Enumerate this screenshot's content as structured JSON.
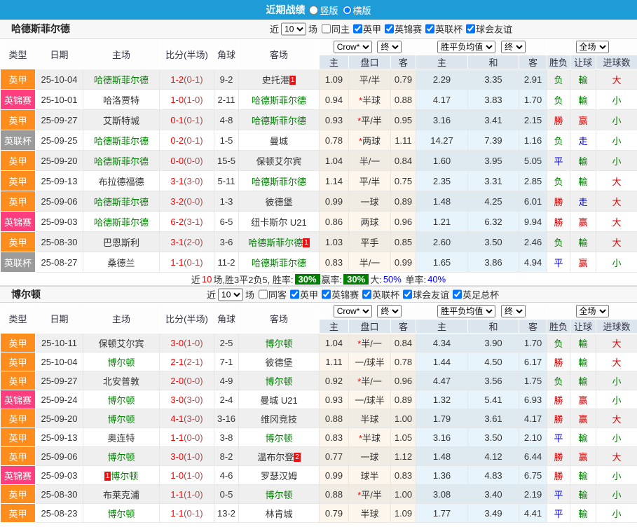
{
  "topbar": {
    "title": "近期战绩",
    "radio_vertical": "竖版",
    "radio_horizontal": "横版",
    "vertical_checked": false,
    "horizontal_checked": true
  },
  "labels": {
    "near": "近",
    "matches": "场"
  },
  "table_headers": {
    "type": "类型",
    "date": "日期",
    "home": "主场",
    "score": "比分(半场)",
    "corner": "角球",
    "away": "客场",
    "odds_home": "主",
    "handicap": "盘口",
    "odds_away": "客",
    "avg_home": "主",
    "avg_draw": "和",
    "avg_away": "客",
    "result": "胜负",
    "let_goal": "让球",
    "goals": "进球数",
    "bookmaker": "Crow*",
    "final": "终",
    "avg_label": "胜平负均值",
    "fullmatch": "全场"
  },
  "sections": [
    {
      "team": "哈德斯菲尔德",
      "filter": {
        "count": "10",
        "same_label": "同主",
        "same_checked": false,
        "leagues": [
          {
            "label": "英甲",
            "checked": true
          },
          {
            "label": "英锦赛",
            "checked": true
          },
          {
            "label": "英联杯",
            "checked": true
          },
          {
            "label": "球会友谊",
            "checked": true
          }
        ]
      },
      "rows": [
        {
          "type": "英甲",
          "tcls": "lg-orange",
          "date": "25-10-04",
          "home": {
            "text": "哈德斯菲尔德",
            "cls": "team-green",
            "badge_pre": "",
            "badge": ""
          },
          "score": "1-2",
          "half": "(0-1)",
          "corner": "9-2",
          "away": {
            "text": "史托港",
            "cls": "",
            "badge_pre": "",
            "badge": "1"
          },
          "o1": "1.09",
          "hstar": "",
          "hc": "平/半",
          "o2": "0.79",
          "a1": "2.29",
          "a2": "3.35",
          "a3": "2.91",
          "res": {
            "text": "负",
            "cls": "g"
          },
          "let": {
            "text": "輸",
            "cls": "g"
          },
          "goal": {
            "text": "大",
            "cls": "r"
          }
        },
        {
          "type": "英锦赛",
          "tcls": "lg-pink",
          "date": "25-10-01",
          "home": {
            "text": "哈洛贾特",
            "cls": "",
            "badge_pre": "",
            "badge": ""
          },
          "score": "1-0",
          "half": "(1-0)",
          "corner": "2-11",
          "away": {
            "text": "哈德斯菲尔德",
            "cls": "team-green",
            "badge_pre": "",
            "badge": ""
          },
          "o1": "0.94",
          "hstar": "*",
          "hc": "半球",
          "o2": "0.88",
          "a1": "4.17",
          "a2": "3.83",
          "a3": "1.70",
          "res": {
            "text": "负",
            "cls": "g"
          },
          "let": {
            "text": "輸",
            "cls": "g"
          },
          "goal": {
            "text": "小",
            "cls": "g"
          }
        },
        {
          "type": "英甲",
          "tcls": "lg-orange",
          "date": "25-09-27",
          "home": {
            "text": "艾斯特城",
            "cls": "",
            "badge_pre": "",
            "badge": ""
          },
          "score": "0-1",
          "half": "(0-1)",
          "corner": "4-8",
          "away": {
            "text": "哈德斯菲尔德",
            "cls": "team-green",
            "badge_pre": "",
            "badge": ""
          },
          "o1": "0.93",
          "hstar": "*",
          "hc": "平/半",
          "o2": "0.95",
          "a1": "3.16",
          "a2": "3.41",
          "a3": "2.15",
          "res": {
            "text": "勝",
            "cls": "r"
          },
          "let": {
            "text": "赢",
            "cls": "r"
          },
          "goal": {
            "text": "小",
            "cls": "g"
          }
        },
        {
          "type": "英联杯",
          "tcls": "lg-gray",
          "date": "25-09-25",
          "home": {
            "text": "哈德斯菲尔德",
            "cls": "team-green",
            "badge_pre": "",
            "badge": ""
          },
          "score": "0-2",
          "half": "(0-1)",
          "corner": "1-5",
          "away": {
            "text": "曼城",
            "cls": "",
            "badge_pre": "",
            "badge": ""
          },
          "o1": "0.78",
          "hstar": "*",
          "hc": "两球",
          "o2": "1.11",
          "a1": "14.27",
          "a2": "7.39",
          "a3": "1.16",
          "res": {
            "text": "负",
            "cls": "g"
          },
          "let": {
            "text": "走",
            "cls": "b"
          },
          "goal": {
            "text": "小",
            "cls": "g"
          }
        },
        {
          "type": "英甲",
          "tcls": "lg-orange",
          "date": "25-09-20",
          "home": {
            "text": "哈德斯菲尔德",
            "cls": "team-green",
            "badge_pre": "",
            "badge": ""
          },
          "score": "0-0",
          "half": "(0-0)",
          "corner": "15-5",
          "away": {
            "text": "保顿艾尔宾",
            "cls": "",
            "badge_pre": "",
            "badge": ""
          },
          "o1": "1.04",
          "hstar": "",
          "hc": "半/一",
          "o2": "0.84",
          "a1": "1.60",
          "a2": "3.95",
          "a3": "5.05",
          "res": {
            "text": "平",
            "cls": "b"
          },
          "let": {
            "text": "輸",
            "cls": "g"
          },
          "goal": {
            "text": "小",
            "cls": "g"
          }
        },
        {
          "type": "英甲",
          "tcls": "lg-orange",
          "date": "25-09-13",
          "home": {
            "text": "布拉德福德",
            "cls": "",
            "badge_pre": "",
            "badge": ""
          },
          "score": "3-1",
          "half": "(3-0)",
          "corner": "5-11",
          "away": {
            "text": "哈德斯菲尔德",
            "cls": "team-green",
            "badge_pre": "",
            "badge": ""
          },
          "o1": "1.14",
          "hstar": "",
          "hc": "平/半",
          "o2": "0.75",
          "a1": "2.35",
          "a2": "3.31",
          "a3": "2.85",
          "res": {
            "text": "负",
            "cls": "g"
          },
          "let": {
            "text": "輸",
            "cls": "g"
          },
          "goal": {
            "text": "大",
            "cls": "r"
          }
        },
        {
          "type": "英甲",
          "tcls": "lg-orange",
          "date": "25-09-06",
          "home": {
            "text": "哈德斯菲尔德",
            "cls": "team-green",
            "badge_pre": "",
            "badge": ""
          },
          "score": "3-2",
          "half": "(0-0)",
          "corner": "1-3",
          "away": {
            "text": "彼德堡",
            "cls": "",
            "badge_pre": "",
            "badge": ""
          },
          "o1": "0.99",
          "hstar": "",
          "hc": "一球",
          "o2": "0.89",
          "a1": "1.48",
          "a2": "4.25",
          "a3": "6.01",
          "res": {
            "text": "勝",
            "cls": "r"
          },
          "let": {
            "text": "走",
            "cls": "b"
          },
          "goal": {
            "text": "大",
            "cls": "r"
          }
        },
        {
          "type": "英锦赛",
          "tcls": "lg-pink",
          "date": "25-09-03",
          "home": {
            "text": "哈德斯菲尔德",
            "cls": "team-green",
            "badge_pre": "",
            "badge": ""
          },
          "score": "6-2",
          "half": "(3-1)",
          "corner": "6-5",
          "away": {
            "text": "纽卡斯尔 U21",
            "cls": "",
            "badge_pre": "",
            "badge": ""
          },
          "o1": "0.86",
          "hstar": "",
          "hc": "两球",
          "o2": "0.96",
          "a1": "1.21",
          "a2": "6.32",
          "a3": "9.94",
          "res": {
            "text": "勝",
            "cls": "r"
          },
          "let": {
            "text": "赢",
            "cls": "r"
          },
          "goal": {
            "text": "大",
            "cls": "r"
          }
        },
        {
          "type": "英甲",
          "tcls": "lg-orange",
          "date": "25-08-30",
          "home": {
            "text": "巴恩斯利",
            "cls": "",
            "badge_pre": "",
            "badge": ""
          },
          "score": "3-1",
          "half": "(2-0)",
          "corner": "3-6",
          "away": {
            "text": "哈德斯菲尔德",
            "cls": "team-green",
            "badge_pre": "",
            "badge": "1"
          },
          "o1": "1.03",
          "hstar": "",
          "hc": "平手",
          "o2": "0.85",
          "a1": "2.60",
          "a2": "3.50",
          "a3": "2.46",
          "res": {
            "text": "负",
            "cls": "g"
          },
          "let": {
            "text": "輸",
            "cls": "g"
          },
          "goal": {
            "text": "大",
            "cls": "r"
          }
        },
        {
          "type": "英联杯",
          "tcls": "lg-gray",
          "date": "25-08-27",
          "home": {
            "text": "桑德兰",
            "cls": "",
            "badge_pre": "",
            "badge": ""
          },
          "score": "1-1",
          "half": "(0-1)",
          "corner": "11-2",
          "away": {
            "text": "哈德斯菲尔德",
            "cls": "team-green",
            "badge_pre": "",
            "badge": ""
          },
          "o1": "0.83",
          "hstar": "",
          "hc": "半/一",
          "o2": "0.99",
          "a1": "1.65",
          "a2": "3.86",
          "a3": "4.94",
          "res": {
            "text": "平",
            "cls": "b"
          },
          "let": {
            "text": "赢",
            "cls": "r"
          },
          "goal": {
            "text": "小",
            "cls": "g"
          }
        }
      ],
      "summary": {
        "pre": "近",
        "n": "10",
        "mid": "场,胜3平2负5, 胜率:",
        "rate1": "30%",
        "mid2": "赢率:",
        "rate2": "30%",
        "mid3": "大:",
        "big": "50%",
        "mid4": "单率:",
        "single": "40%"
      }
    },
    {
      "team": "博尔顿",
      "filter": {
        "count": "10",
        "same_label": "同客",
        "same_checked": false,
        "leagues": [
          {
            "label": "英甲",
            "checked": true
          },
          {
            "label": "英锦赛",
            "checked": true
          },
          {
            "label": "英联杯",
            "checked": true
          },
          {
            "label": "球会友谊",
            "checked": true
          },
          {
            "label": "英足总杯",
            "checked": true
          }
        ]
      },
      "rows": [
        {
          "type": "英甲",
          "tcls": "lg-orange",
          "date": "25-10-11",
          "home": {
            "text": "保顿艾尔宾",
            "cls": "",
            "badge_pre": "",
            "badge": ""
          },
          "score": "3-0",
          "half": "(1-0)",
          "corner": "2-5",
          "away": {
            "text": "博尔顿",
            "cls": "team-green",
            "badge_pre": "",
            "badge": ""
          },
          "o1": "1.04",
          "hstar": "*",
          "hc": "半/一",
          "o2": "0.84",
          "a1": "4.34",
          "a2": "3.90",
          "a3": "1.70",
          "res": {
            "text": "负",
            "cls": "g"
          },
          "let": {
            "text": "輸",
            "cls": "g"
          },
          "goal": {
            "text": "大",
            "cls": "r"
          }
        },
        {
          "type": "英甲",
          "tcls": "lg-orange",
          "date": "25-10-04",
          "home": {
            "text": "博尔顿",
            "cls": "team-green",
            "badge_pre": "",
            "badge": ""
          },
          "score": "2-1",
          "half": "(2-1)",
          "corner": "7-1",
          "away": {
            "text": "彼德堡",
            "cls": "",
            "badge_pre": "",
            "badge": ""
          },
          "o1": "1.11",
          "hstar": "",
          "hc": "一/球半",
          "o2": "0.78",
          "a1": "1.44",
          "a2": "4.50",
          "a3": "6.17",
          "res": {
            "text": "勝",
            "cls": "r"
          },
          "let": {
            "text": "輸",
            "cls": "g"
          },
          "goal": {
            "text": "大",
            "cls": "r"
          }
        },
        {
          "type": "英甲",
          "tcls": "lg-orange",
          "date": "25-09-27",
          "home": {
            "text": "北安普敦",
            "cls": "",
            "badge_pre": "",
            "badge": ""
          },
          "score": "2-0",
          "half": "(0-0)",
          "corner": "4-9",
          "away": {
            "text": "博尔顿",
            "cls": "team-green",
            "badge_pre": "",
            "badge": ""
          },
          "o1": "0.92",
          "hstar": "*",
          "hc": "半/一",
          "o2": "0.96",
          "a1": "4.47",
          "a2": "3.56",
          "a3": "1.75",
          "res": {
            "text": "负",
            "cls": "g"
          },
          "let": {
            "text": "輸",
            "cls": "g"
          },
          "goal": {
            "text": "小",
            "cls": "g"
          }
        },
        {
          "type": "英锦赛",
          "tcls": "lg-pink",
          "date": "25-09-24",
          "home": {
            "text": "博尔顿",
            "cls": "team-green",
            "badge_pre": "",
            "badge": ""
          },
          "score": "3-0",
          "half": "(3-0)",
          "corner": "2-4",
          "away": {
            "text": "曼城 U21",
            "cls": "",
            "badge_pre": "",
            "badge": ""
          },
          "o1": "0.93",
          "hstar": "",
          "hc": "一/球半",
          "o2": "0.89",
          "a1": "1.32",
          "a2": "5.41",
          "a3": "6.93",
          "res": {
            "text": "勝",
            "cls": "r"
          },
          "let": {
            "text": "赢",
            "cls": "r"
          },
          "goal": {
            "text": "小",
            "cls": "g"
          }
        },
        {
          "type": "英甲",
          "tcls": "lg-orange",
          "date": "25-09-20",
          "home": {
            "text": "博尔顿",
            "cls": "team-green",
            "badge_pre": "",
            "badge": ""
          },
          "score": "4-1",
          "half": "(3-0)",
          "corner": "3-16",
          "away": {
            "text": "维冈竞技",
            "cls": "",
            "badge_pre": "",
            "badge": ""
          },
          "o1": "0.88",
          "hstar": "",
          "hc": "半球",
          "o2": "1.00",
          "a1": "1.79",
          "a2": "3.61",
          "a3": "4.17",
          "res": {
            "text": "勝",
            "cls": "r"
          },
          "let": {
            "text": "赢",
            "cls": "r"
          },
          "goal": {
            "text": "大",
            "cls": "r"
          }
        },
        {
          "type": "英甲",
          "tcls": "lg-orange",
          "date": "25-09-13",
          "home": {
            "text": "奥连特",
            "cls": "",
            "badge_pre": "",
            "badge": ""
          },
          "score": "1-1",
          "half": "(0-0)",
          "corner": "3-8",
          "away": {
            "text": "博尔顿",
            "cls": "team-green",
            "badge_pre": "",
            "badge": ""
          },
          "o1": "0.83",
          "hstar": "*",
          "hc": "半球",
          "o2": "1.05",
          "a1": "3.16",
          "a2": "3.50",
          "a3": "2.10",
          "res": {
            "text": "平",
            "cls": "b"
          },
          "let": {
            "text": "輸",
            "cls": "g"
          },
          "goal": {
            "text": "小",
            "cls": "g"
          }
        },
        {
          "type": "英甲",
          "tcls": "lg-orange",
          "date": "25-09-06",
          "home": {
            "text": "博尔顿",
            "cls": "team-green",
            "badge_pre": "",
            "badge": ""
          },
          "score": "3-0",
          "half": "(1-0)",
          "corner": "8-2",
          "away": {
            "text": "温布尔登",
            "cls": "",
            "badge_pre": "",
            "badge": "2"
          },
          "o1": "0.77",
          "hstar": "",
          "hc": "一球",
          "o2": "1.12",
          "a1": "1.48",
          "a2": "4.12",
          "a3": "6.44",
          "res": {
            "text": "勝",
            "cls": "r"
          },
          "let": {
            "text": "赢",
            "cls": "r"
          },
          "goal": {
            "text": "大",
            "cls": "r"
          }
        },
        {
          "type": "英锦赛",
          "tcls": "lg-pink",
          "date": "25-09-03",
          "home": {
            "text": "博尔顿",
            "cls": "team-green",
            "badge_pre": "1",
            "badge": ""
          },
          "score": "1-0",
          "half": "(1-0)",
          "corner": "4-6",
          "away": {
            "text": "罗瑟汉姆",
            "cls": "",
            "badge_pre": "",
            "badge": ""
          },
          "o1": "0.99",
          "hstar": "",
          "hc": "球半",
          "o2": "0.83",
          "a1": "1.36",
          "a2": "4.83",
          "a3": "6.75",
          "res": {
            "text": "勝",
            "cls": "r"
          },
          "let": {
            "text": "輸",
            "cls": "g"
          },
          "goal": {
            "text": "小",
            "cls": "g"
          }
        },
        {
          "type": "英甲",
          "tcls": "lg-orange",
          "date": "25-08-30",
          "home": {
            "text": "布莱克浦",
            "cls": "",
            "badge_pre": "",
            "badge": ""
          },
          "score": "1-1",
          "half": "(1-0)",
          "corner": "0-5",
          "away": {
            "text": "博尔顿",
            "cls": "team-green",
            "badge_pre": "",
            "badge": ""
          },
          "o1": "0.88",
          "hstar": "*",
          "hc": "平/半",
          "o2": "1.00",
          "a1": "3.08",
          "a2": "3.40",
          "a3": "2.19",
          "res": {
            "text": "平",
            "cls": "b"
          },
          "let": {
            "text": "輸",
            "cls": "g"
          },
          "goal": {
            "text": "小",
            "cls": "g"
          }
        },
        {
          "type": "英甲",
          "tcls": "lg-orange",
          "date": "25-08-23",
          "home": {
            "text": "博尔顿",
            "cls": "team-green",
            "badge_pre": "",
            "badge": ""
          },
          "score": "1-1",
          "half": "(0-1)",
          "corner": "13-2",
          "away": {
            "text": "林肯城",
            "cls": "",
            "badge_pre": "",
            "badge": ""
          },
          "o1": "0.79",
          "hstar": "",
          "hc": "半球",
          "o2": "1.09",
          "a1": "1.77",
          "a2": "3.49",
          "a3": "4.41",
          "res": {
            "text": "平",
            "cls": "b"
          },
          "let": {
            "text": "輸",
            "cls": "g"
          },
          "goal": {
            "text": "小",
            "cls": "g"
          }
        }
      ]
    }
  ]
}
